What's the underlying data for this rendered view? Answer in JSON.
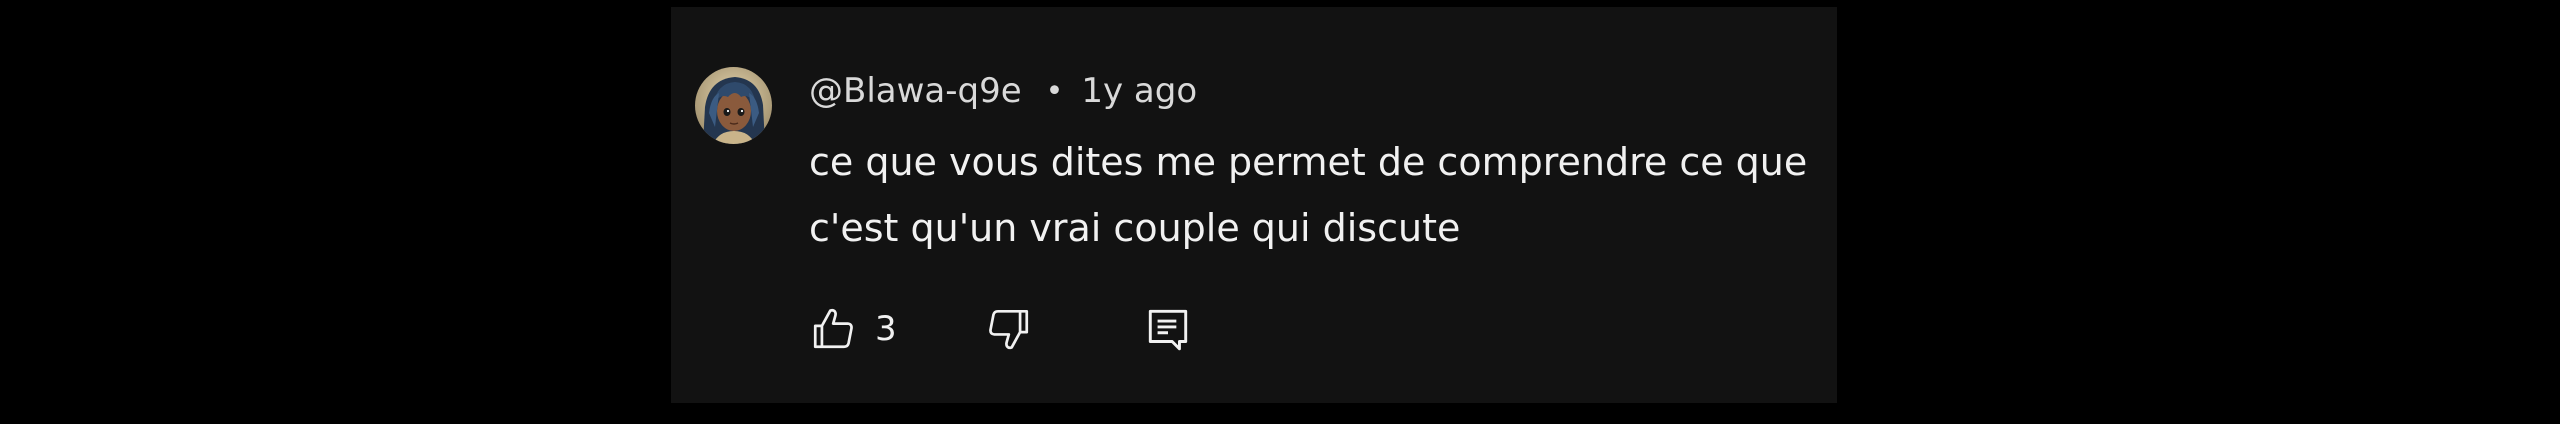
{
  "comment": {
    "author": "@Blawa-q9e",
    "separator": "•",
    "timestamp": "1y ago",
    "text": "ce que vous dites me permet de comprendre ce que c'est qu'un vrai couple qui discute",
    "avatar": "avatar-image"
  },
  "actions": {
    "like_icon": "thumbs-up-icon",
    "like_count": "3",
    "dislike_icon": "thumbs-down-icon",
    "reply_icon": "reply-comment-icon"
  },
  "colors": {
    "page_background": "#000000",
    "card_background": "#121212",
    "text_primary": "#f1f1f1",
    "text_secondary": "#d9d9d9"
  }
}
